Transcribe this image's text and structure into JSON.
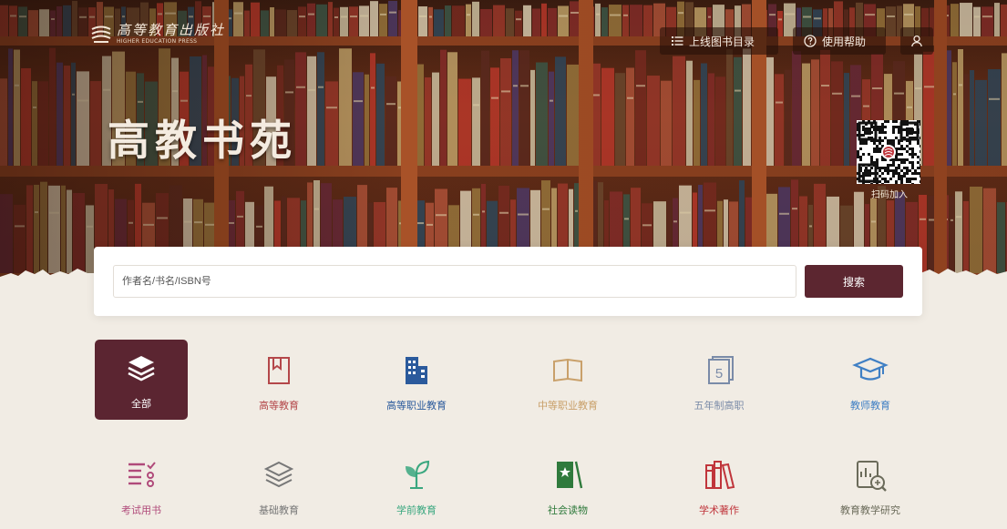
{
  "logo": {
    "name_cn": "高等教育出版社",
    "name_en": "HIGHER EDUCATION PRESS"
  },
  "hero": {
    "title": "高教书苑"
  },
  "nav": {
    "catalog_label": "上线图书目录",
    "catalog_icon": "list-icon",
    "help_label": "使用帮助",
    "help_icon": "question-circle-icon",
    "user_icon": "user-icon"
  },
  "qr": {
    "label": "扫码加入"
  },
  "search": {
    "placeholder": "作者名/书名/ISBN号",
    "value": "",
    "button_label": "搜索"
  },
  "colors": {
    "accent": "#5b2531",
    "background": "#f1ece4"
  },
  "categories": [
    {
      "label": "全部",
      "icon": "layers-icon",
      "color": "#ffffff",
      "active": true
    },
    {
      "label": "高等教育",
      "icon": "book-bookmark-icon",
      "color": "#b4474a"
    },
    {
      "label": "高等职业教育",
      "icon": "building-icon",
      "color": "#2b5a9c"
    },
    {
      "label": "中等职业教育",
      "icon": "open-book-icon",
      "color": "#c9a06a"
    },
    {
      "label": "五年制高职",
      "icon": "number-five-icon",
      "color": "#7a8ba8"
    },
    {
      "label": "教师教育",
      "icon": "graduation-cap-icon",
      "color": "#3f7fc4"
    },
    {
      "label": "考试用书",
      "icon": "checklist-icon",
      "color": "#b04a7a"
    },
    {
      "label": "基础教育",
      "icon": "layers-outline-icon",
      "color": "#777777"
    },
    {
      "label": "学前教育",
      "icon": "sprout-icon",
      "color": "#3aa77f"
    },
    {
      "label": "社会读物",
      "icon": "star-book-icon",
      "color": "#2f7a3c"
    },
    {
      "label": "学术著作",
      "icon": "books-icon",
      "color": "#c0353b"
    },
    {
      "label": "教育教学研究",
      "icon": "report-search-icon",
      "color": "#6b6b5a"
    }
  ]
}
